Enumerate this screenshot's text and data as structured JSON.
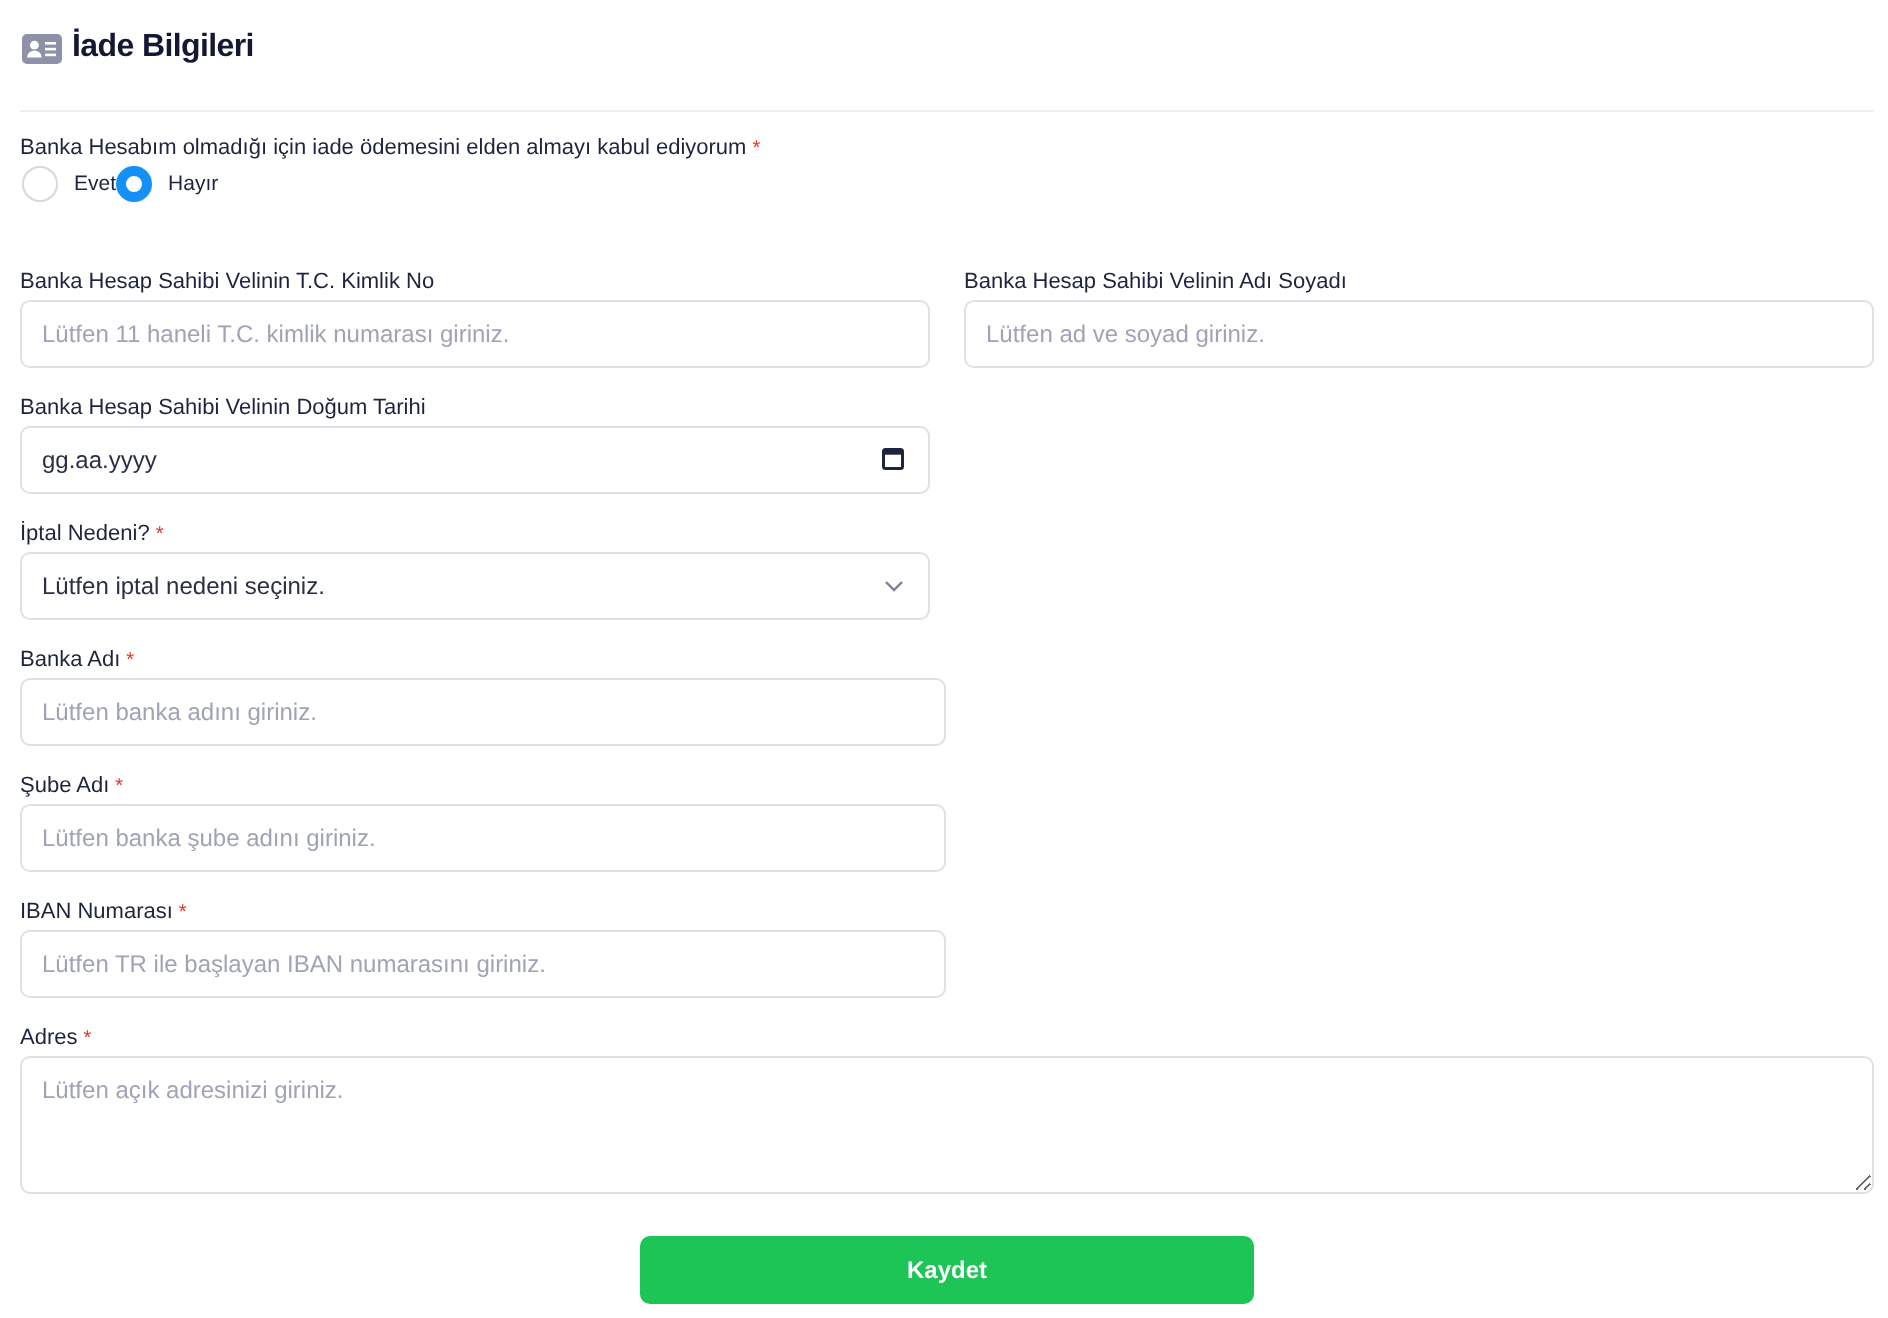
{
  "header": {
    "title": "İade Bilgileri"
  },
  "consent": {
    "label": "Banka Hesabım olmadığı için iade ödemesini elden almayı kabul ediyorum",
    "required_mark": "*",
    "options": [
      {
        "label": "Evet",
        "selected": false
      },
      {
        "label": "Hayır",
        "selected": true
      }
    ]
  },
  "field_rows": [
    [
      {
        "kind": "text",
        "label": "Banka Hesap Sahibi Velinin T.C. Kimlik No",
        "placeholder": "Lütfen 11 haneli T.C. kimlik numarası giriniz."
      },
      {
        "kind": "text",
        "label": "Banka Hesap Sahibi Velinin Adı Soyadı",
        "placeholder": "Lütfen ad ve soyad giriniz."
      }
    ],
    [
      {
        "kind": "date",
        "label": "Banka Hesap Sahibi Velinin Doğum Tarihi",
        "placeholder": "gg.aa.yyyy"
      }
    ],
    [
      {
        "kind": "select",
        "label": "İptal Nedeni?",
        "required_mark": "*",
        "value": "Lütfen iptal nedeni seçiniz."
      }
    ]
  ],
  "bank_fields": [
    {
      "kind": "text",
      "label": "Banka Adı",
      "required_mark": "*",
      "placeholder": "Lütfen banka adını giriniz."
    },
    {
      "kind": "text",
      "label": "Şube Adı",
      "required_mark": "*",
      "placeholder": "Lütfen banka şube adını giriniz."
    },
    {
      "kind": "text",
      "label": "IBAN Numarası",
      "required_mark": "*",
      "placeholder": "Lütfen TR ile başlayan IBAN numarasını giriniz."
    }
  ],
  "address": {
    "kind": "textarea",
    "label": "Adres",
    "required_mark": "*",
    "placeholder": "Lütfen açık adresinizi giriniz."
  },
  "submit": {
    "label": "Kaydet"
  }
}
